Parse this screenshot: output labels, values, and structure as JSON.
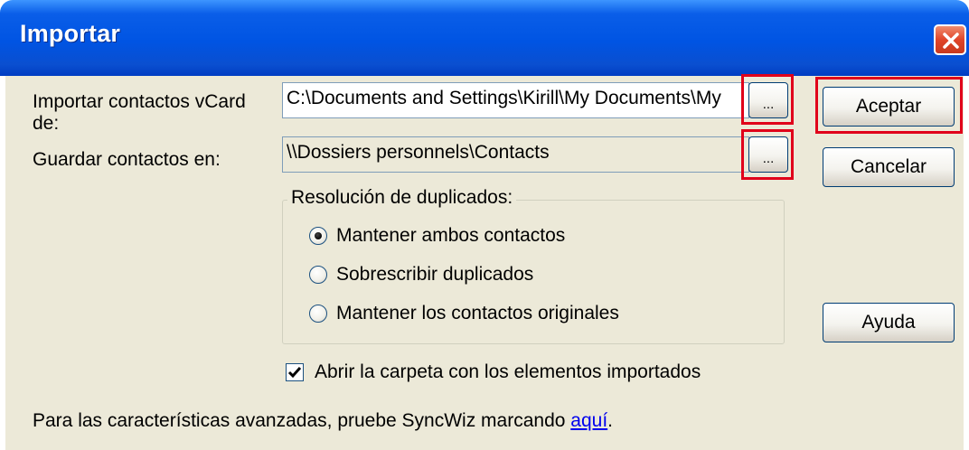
{
  "window": {
    "title": "Importar",
    "close_icon": "close-icon"
  },
  "import": {
    "label": "Importar contactos vCard de:",
    "label_line1": "Importar contactos vCard",
    "label_line2": "de:",
    "path_value": "C:\\Documents and Settings\\Kirill\\My Documents\\My",
    "browse_label": "..."
  },
  "save": {
    "label": "Guardar contactos en:",
    "path_value": "\\\\Dossiers personnels\\Contacts",
    "browse_label": "..."
  },
  "duplicates": {
    "legend": "Resolución de duplicados:",
    "options": [
      {
        "label": "Mantener ambos contactos",
        "selected": true
      },
      {
        "label": "Sobrescribir duplicados",
        "selected": false
      },
      {
        "label": "Mantener los contactos originales",
        "selected": false
      }
    ]
  },
  "open_folder": {
    "label": "Abrir la carpeta con los elementos importados",
    "checked": true
  },
  "buttons": {
    "accept": "Aceptar",
    "cancel": "Cancelar",
    "help": "Ayuda"
  },
  "footer": {
    "text": "Para las características avanzadas, pruebe SyncWiz marcando ",
    "link": "aquí",
    "suffix": "."
  },
  "colors": {
    "title_bar": "#0054e3",
    "dialog_bg": "#ece9d8",
    "highlight": "#e0001a",
    "close_button": "#e0452a"
  }
}
